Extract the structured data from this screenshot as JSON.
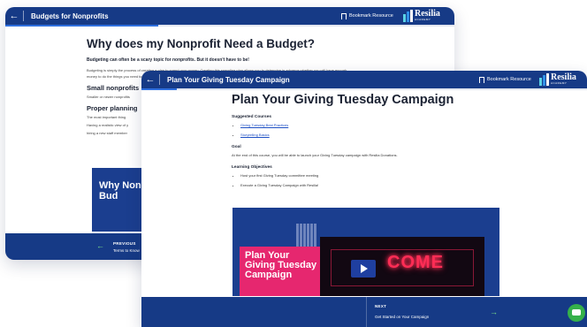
{
  "colors": {
    "brand": "#163a86",
    "accent": "#2f6fde",
    "arrow": "#7be08a",
    "poster": "#e6276f",
    "chat": "#35b14a"
  },
  "back_window": {
    "header": {
      "back_icon": "arrow-left-icon",
      "title": "Budgets for Nonprofits",
      "bookmark_label": "Bookmark Resource"
    },
    "logo": {
      "name": "Resilia",
      "sub": "ACADEMY"
    },
    "progress": 0.34,
    "page": {
      "title": "Why does my Nonprofit Need a Budget?",
      "lead": "Budgeting can often be a scary topic for nonprofits. But it doesn't have to be!",
      "intro": "Budgeting is simply the process of creating a plan to spend your money. Creating this spending plan allows you to determine in advance whether you will have enough money to do the things you need to do or would like to do.",
      "section1": "Small nonprofits",
      "section1_text": "Smaller or newer nonprofits",
      "section2": "Proper planning",
      "section2_text1": "The most important thing",
      "section2_text2": "Having a realistic view of y",
      "section2_text3": "hiring a new staff member",
      "hero": "Why Non Bud"
    },
    "footer": {
      "prev_label": "PREVIOUS",
      "prev_value": "Terms to Know"
    }
  },
  "front_window": {
    "header": {
      "back_icon": "arrow-left-icon",
      "title": "Plan Your Giving Tuesday Campaign",
      "bookmark_label": "Bookmark Resource"
    },
    "logo": {
      "name": "Resilia",
      "sub": "ACADEMY"
    },
    "progress": 0.08,
    "page": {
      "title": "Plan Your Giving Tuesday Campaign",
      "suggested_heading": "Suggested Courses",
      "courses": [
        "Giving Tuesday Best Practices",
        "Storytelling Basics"
      ],
      "goal_heading": "Goal",
      "goal_text": "At the end of this course, you will be able to launch your Giving Tuesday campaign with Resilia Donations.",
      "objectives_heading": "Learning Objectives",
      "objectives": [
        "Host your first Giving Tuesday committee meeting",
        "Execute a Giving Tuesday Campaign with Resilia!"
      ],
      "poster_text": "Plan Your Giving Tuesday Campaign",
      "video_text": "COME"
    },
    "footer": {
      "next_label": "NEXT",
      "next_value": "Get Started on Your Campaign"
    }
  }
}
